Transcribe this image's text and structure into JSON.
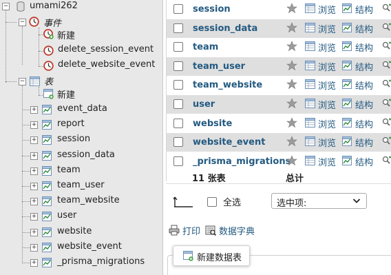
{
  "nav": {
    "db_name": "umami262",
    "events_label": "事件",
    "events_new": "新建",
    "events": [
      "delete_session_event",
      "delete_website_event"
    ],
    "tables_label": "表",
    "tables_new": "新建",
    "tables": [
      "event_data",
      "report",
      "session",
      "session_data",
      "team",
      "team_user",
      "team_website",
      "user",
      "website",
      "website_event",
      "_prisma_migrations"
    ]
  },
  "table_list": {
    "rows": [
      {
        "name": "session"
      },
      {
        "name": "session_data"
      },
      {
        "name": "team"
      },
      {
        "name": "team_user"
      },
      {
        "name": "team_website"
      },
      {
        "name": "user"
      },
      {
        "name": "website"
      },
      {
        "name": "website_event"
      },
      {
        "name": "_prisma_migrations"
      }
    ],
    "browse_label": "浏览",
    "structure_label": "结构",
    "footer_count": "11 张表",
    "footer_sum": "总计"
  },
  "controls": {
    "select_all_label": "全选",
    "with_selected_value": "选中项:"
  },
  "links": {
    "print_label": "打印",
    "dictionary_label": "数据字典"
  },
  "create": {
    "new_table_label": "新建数据表"
  },
  "colors": {
    "link": "#235a81",
    "nav_bg": "#e8e8e8",
    "row_alt": "#dfdfdf"
  }
}
